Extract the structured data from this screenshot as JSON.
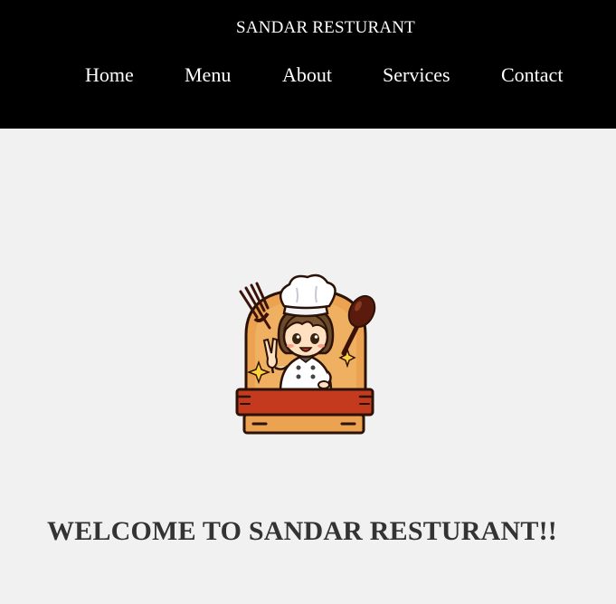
{
  "header": {
    "site_title": "SANDAR RESTURANT",
    "nav": {
      "home": "Home",
      "menu": "Menu",
      "about": "About",
      "services": "Services",
      "contact": "Contact"
    }
  },
  "hero": {
    "logo_icon": "chef-mascot-logo-icon",
    "welcome_text": "WELCOME TO SANDAR RESTURANT!!"
  },
  "colors": {
    "header_bg": "#000000",
    "page_bg": "#f1f1f1",
    "nav_text": "#ffffff",
    "heading_text": "#333333",
    "logo_orange": "#eba352",
    "logo_red": "#c43a1e"
  }
}
